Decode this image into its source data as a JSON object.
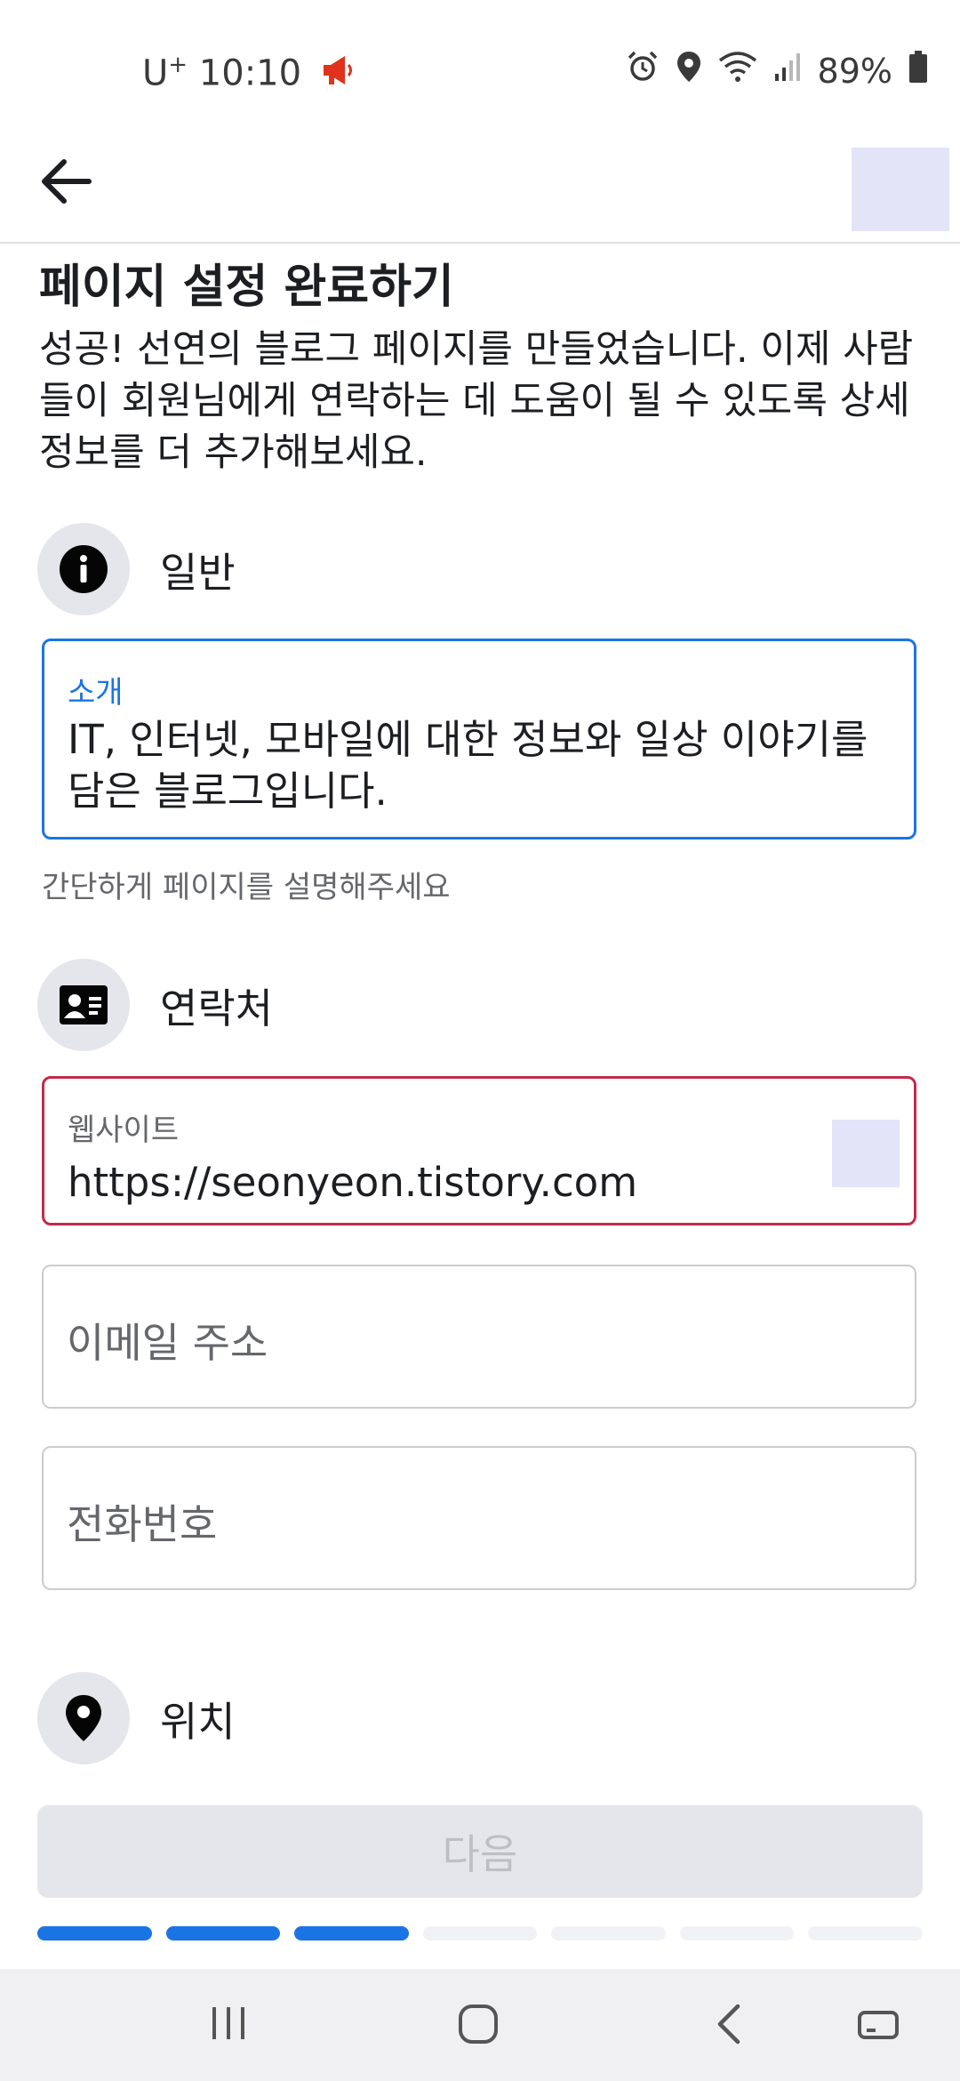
{
  "status_bar": {
    "carrier": "U",
    "carrier_sup": "+",
    "time": "10:10",
    "battery": "89%"
  },
  "header": {
    "back_icon": "arrow-left-icon"
  },
  "page": {
    "title": "페이지 설정 완료하기",
    "description": "성공! 선연의 블로그 페이지를 만들었습니다. 이제 사람들이 회원님에게 연락하는 데 도움이 될 수 있도록 상세 정보를 더 추가해보세요."
  },
  "sections": {
    "general": {
      "label": "일반",
      "icon": "info-icon"
    },
    "contact": {
      "label": "연락처",
      "icon": "contact-card-icon"
    },
    "location": {
      "label": "위치",
      "icon": "location-pin-icon"
    }
  },
  "fields": {
    "about": {
      "label": "소개",
      "value": "IT, 인터넷, 모바일에 대한 정보와 일상 이야기를 담은 블로그입니다.",
      "helper": "간단하게 페이지를 설명해주세요"
    },
    "website": {
      "label": "웹사이트",
      "value": "https://seonyeon.tistory.com"
    },
    "email": {
      "placeholder": "이메일 주소"
    },
    "phone": {
      "placeholder": "전화번호"
    }
  },
  "footer": {
    "next_label": "다음",
    "progress": {
      "completed": 3,
      "total": 7
    }
  },
  "colors": {
    "accent": "#1b74e4",
    "error": "#c5294a",
    "notification": "#e0321c"
  }
}
